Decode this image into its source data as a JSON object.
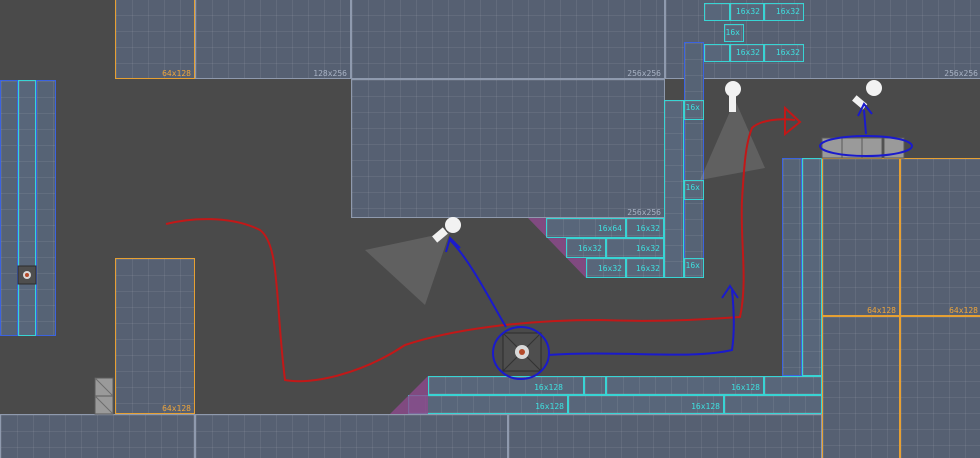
{
  "labels": {
    "l64x128": "64x128",
    "l128x256": "128x256",
    "l256x256": "256x256",
    "l16x32": "16x32",
    "l16x64": "16x64",
    "l16x128": "16x128",
    "l16x": "16x",
    "l64": "64",
    "l16x32_short": "16x3",
    "l1": "1",
    "l16": "16x",
    "l6": "6"
  },
  "colors": {
    "background": "#4a4a4a",
    "block_fill": "#566072",
    "border_gray": "#8f9aae",
    "border_orange": "#e6a033",
    "border_cyan": "#38d4d4",
    "border_blue": "#3b63e0",
    "ramp_pink": "#b45bb4",
    "path_red": "#c21818",
    "path_blue": "#1a1acc"
  },
  "icons": [
    "spotlight-icon",
    "portal-button-icon",
    "storage-cube-icon",
    "path-arrow-icon"
  ]
}
